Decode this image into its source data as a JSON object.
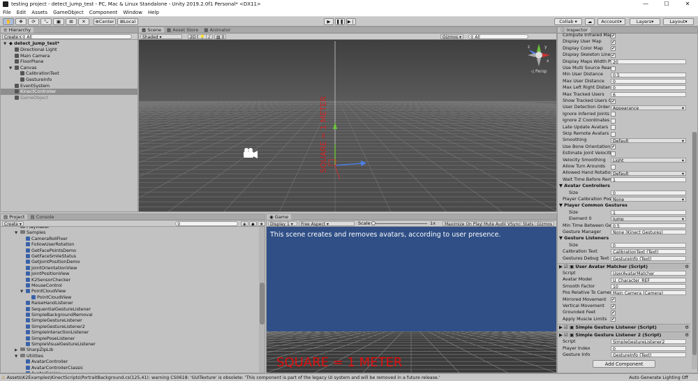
{
  "window": {
    "title": "testing project - detect_jump_test - PC, Mac & Linux Standalone - Unity 2019.2.0f1 Personal* <DX11>",
    "min": "—",
    "max": "☐",
    "close": "✕"
  },
  "menu": [
    "File",
    "Edit",
    "Assets",
    "GameObject",
    "Component",
    "Window",
    "Help"
  ],
  "toolbar": {
    "center": "Center",
    "local": "Local",
    "collab": "Collab ▾",
    "account": "Account",
    "layers": "Layers",
    "layout": "Layout"
  },
  "hierarchy": {
    "tab": "Hierarchy",
    "create": "Create",
    "search": "All",
    "scene": "detect_jump_test*",
    "items": [
      {
        "label": "Directional Light",
        "depth": 1
      },
      {
        "label": "Main Camera",
        "depth": 1
      },
      {
        "label": "FloorPlane",
        "depth": 1
      },
      {
        "label": "Canvas",
        "depth": 1,
        "fold": "▼"
      },
      {
        "label": "CalibrationText",
        "depth": 2
      },
      {
        "label": "GestureInfo",
        "depth": 2
      },
      {
        "label": "EventSystem",
        "depth": 1
      },
      {
        "label": "KinectController",
        "depth": 1,
        "selected": true
      },
      {
        "label": "GameObject",
        "depth": 1,
        "dim": true
      }
    ]
  },
  "scene": {
    "tabs": [
      "Scene",
      "Asset Store",
      "Animator"
    ],
    "shaded": "Shaded",
    "mode2d": "2D",
    "gizmos": "Gizmos",
    "search": "All",
    "fx": "0",
    "persp": "◁ Persp",
    "axis_y": "y",
    "axis_x": "x",
    "axis_z": "z"
  },
  "project": {
    "tabs": [
      "Project",
      "Console"
    ],
    "create": "Create",
    "items": [
      {
        "label": "PlayMaker",
        "depth": 2,
        "type": "folder"
      },
      {
        "label": "Samples",
        "depth": 2,
        "type": "folder",
        "fold": "▼"
      },
      {
        "label": "CameraRollFixer",
        "depth": 3,
        "type": "script"
      },
      {
        "label": "FollowUserRotation",
        "depth": 3,
        "type": "script"
      },
      {
        "label": "GetFacePointsDemo",
        "depth": 3,
        "type": "script"
      },
      {
        "label": "GetFaceSmileStatus",
        "depth": 3,
        "type": "script"
      },
      {
        "label": "GetJointPositionDemo",
        "depth": 3,
        "type": "script"
      },
      {
        "label": "JointOrientationView",
        "depth": 3,
        "type": "script"
      },
      {
        "label": "JointPositionView",
        "depth": 3,
        "type": "script"
      },
      {
        "label": "K2SensorChecker",
        "depth": 3,
        "type": "script"
      },
      {
        "label": "MouseControl",
        "depth": 3,
        "type": "script"
      },
      {
        "label": "PointCloudView",
        "depth": 3,
        "type": "script",
        "fold": "▼"
      },
      {
        "label": "PointCloudView",
        "depth": 4,
        "type": "script"
      },
      {
        "label": "RaiseHandListener",
        "depth": 3,
        "type": "script"
      },
      {
        "label": "SequentialGestureListener",
        "depth": 3,
        "type": "script"
      },
      {
        "label": "SimpleBackgroundRemoval",
        "depth": 3,
        "type": "script"
      },
      {
        "label": "SimpleGestureListener",
        "depth": 3,
        "type": "script"
      },
      {
        "label": "SimpleGestureListener2",
        "depth": 3,
        "type": "script"
      },
      {
        "label": "SimpleInteractionListener",
        "depth": 3,
        "type": "script"
      },
      {
        "label": "SimplePoseListener",
        "depth": 3,
        "type": "script"
      },
      {
        "label": "SimpleVisualGestureListener",
        "depth": 3,
        "type": "script"
      },
      {
        "label": "SharpZipLib",
        "depth": 2,
        "type": "folder",
        "fold": "▶"
      },
      {
        "label": "Utilities",
        "depth": 2,
        "type": "folder",
        "fold": "▼"
      },
      {
        "label": "AvatarController",
        "depth": 3,
        "type": "script"
      },
      {
        "label": "AvatarControllerClassic",
        "depth": 3,
        "type": "script"
      },
      {
        "label": "AvatarScaler",
        "depth": 3,
        "type": "script"
      }
    ]
  },
  "game": {
    "tab": "Game",
    "display": "Display 1",
    "aspect": "Free Aspect",
    "scale_label": "Scale",
    "scale_val": "1x",
    "maximize": "Maximize On Play",
    "mute": "Mute Audio",
    "vsync": "VSync",
    "stats": "Stats",
    "gizmos": "Gizmos",
    "message": "This scene creates and removes avatars, according to user presence.",
    "floor_text": "SQUARE = 1 METER"
  },
  "inspector": {
    "tab": "Inspector",
    "rows": [
      {
        "label": "Compute Infrared Map",
        "type": "check",
        "value": "✔"
      },
      {
        "label": "Display User Map",
        "type": "check",
        "value": "✔"
      },
      {
        "label": "Display Color Map",
        "type": "check",
        "value": "✔"
      },
      {
        "label": "Display Skeleton Lines",
        "type": "check",
        "value": "✔"
      },
      {
        "label": "Display Maps Width Per",
        "type": "field",
        "value": "20"
      },
      {
        "label": "Use Multi Source Reade",
        "type": "check",
        "value": ""
      },
      {
        "label": "Min User Distance",
        "type": "field",
        "value": "0.5"
      },
      {
        "label": "Max User Distance",
        "type": "field",
        "value": "0"
      },
      {
        "label": "Max Left Right Distance",
        "type": "field",
        "value": "0"
      },
      {
        "label": "Max Tracked Users",
        "type": "field",
        "value": "6"
      },
      {
        "label": "Show Tracked Users On",
        "type": "check",
        "value": "✔"
      },
      {
        "label": "User Detection Order",
        "type": "drop",
        "value": "Appearance"
      },
      {
        "label": "Ignore Inferred Joints",
        "type": "check",
        "value": ""
      },
      {
        "label": "Ignore Z Coordinates",
        "type": "check",
        "value": ""
      },
      {
        "label": "Late Update Avatars",
        "type": "check",
        "value": ""
      },
      {
        "label": "Skip Remote Avatars",
        "type": "check",
        "value": ""
      },
      {
        "label": "Smoothing",
        "type": "drop",
        "value": "Default"
      },
      {
        "label": "Use Bone Orientation C",
        "type": "check",
        "value": "✔"
      },
      {
        "label": "Estimate Joint Velocitie",
        "type": "check",
        "value": ""
      },
      {
        "label": "Velocity Smoothing",
        "type": "drop",
        "value": "Light"
      },
      {
        "label": "Allow Turn Arounds",
        "type": "check",
        "value": ""
      },
      {
        "label": "Allowed Hand Rotations",
        "type": "drop",
        "value": "Default"
      },
      {
        "label": "Wait Time Before Remo",
        "type": "field",
        "value": "1"
      },
      {
        "label": "▼ Avatar Controllers",
        "type": "section",
        "value": ""
      },
      {
        "label": "Size",
        "type": "field",
        "value": "0",
        "indent": true
      },
      {
        "label": "Player Calibration Pose",
        "type": "drop",
        "value": "None"
      },
      {
        "label": "▼ Player Common Gestures",
        "type": "section",
        "value": ""
      },
      {
        "label": "Size",
        "type": "field",
        "value": "1",
        "indent": true
      },
      {
        "label": "Element 0",
        "type": "drop",
        "value": "Jump",
        "indent": true
      },
      {
        "label": "Min Time Between Gest",
        "type": "field",
        "value": "0.5"
      },
      {
        "label": "Gesture Manager",
        "type": "field",
        "value": "None (Kinect Gestures)"
      },
      {
        "label": "▼ Gesture Listeners",
        "type": "section",
        "value": ""
      },
      {
        "label": "Size",
        "type": "field",
        "value": "0",
        "indent": true
      },
      {
        "label": "Calibration Text",
        "type": "field",
        "value": "CalibrationText (Text)"
      },
      {
        "label": "Gestures Debug Text",
        "type": "field",
        "value": "GestureInfo (Text)"
      }
    ],
    "component1": {
      "title": "User Avatar Matcher (Script)",
      "rows": [
        {
          "label": "Script",
          "type": "field",
          "value": "UserAvatarMatcher"
        },
        {
          "label": "Avatar Model",
          "type": "field",
          "value": "U_Character_REF"
        },
        {
          "label": "Smooth Factor",
          "type": "field",
          "value": "10"
        },
        {
          "label": "Pos Relative To Camera",
          "type": "field",
          "value": "Main Camera (Camera)"
        },
        {
          "label": "Mirrored Movement",
          "type": "check",
          "value": "✔"
        },
        {
          "label": "Vertical Movement",
          "type": "check",
          "value": "✔"
        },
        {
          "label": "Grounded Feet",
          "type": "check",
          "value": "✔"
        },
        {
          "label": "Apply Muscle Limits",
          "type": "check",
          "value": "✔"
        }
      ]
    },
    "component2": {
      "title": "Simple Gesture Listener (Script)"
    },
    "component3": {
      "title": "Simple Gesture Listener 2 (Script)",
      "rows": [
        {
          "label": "Script",
          "type": "field",
          "value": "SimpleGestureListener2"
        },
        {
          "label": "Player Index",
          "type": "field",
          "value": "0"
        },
        {
          "label": "Gesture Info",
          "type": "field",
          "value": "GestureInfo (Text)"
        }
      ]
    },
    "add_component": "Add Component"
  },
  "status": {
    "message": "Assets\\K2Examples\\KinectScripts\\PortraitBackground.cs(125,41): warning CS0618: 'GUITexture' is obsolete: 'This component is part of the legacy UI system and will be removed in a future release.'",
    "lighting": "Auto Generate Lighting Off"
  }
}
